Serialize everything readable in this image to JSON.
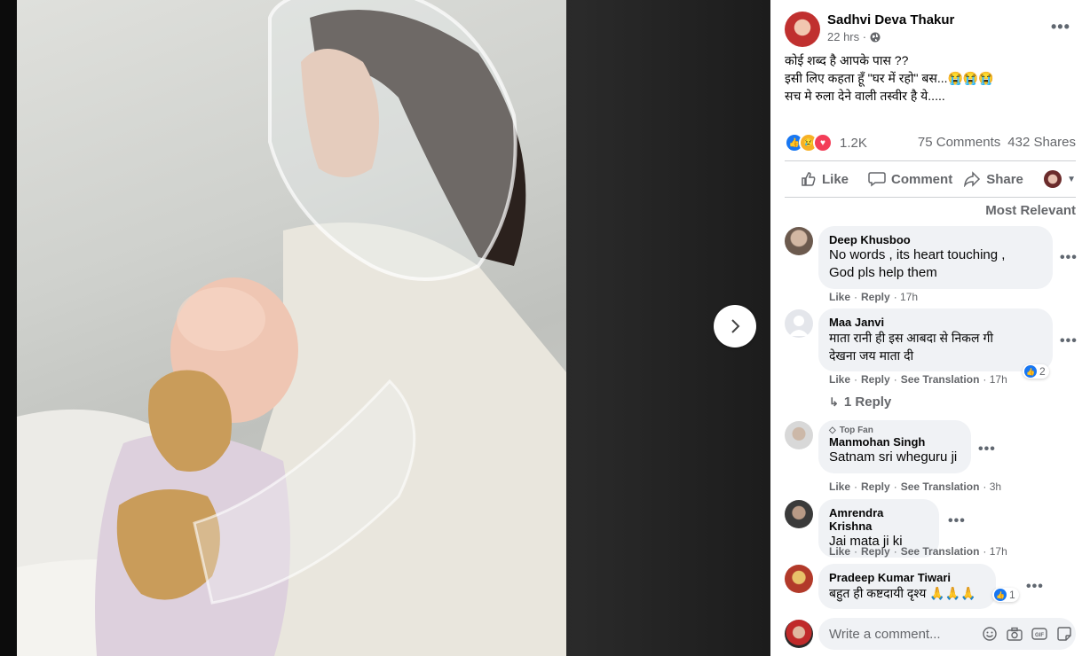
{
  "post": {
    "author": "Sadhvi Deva Thakur",
    "time": "22 hrs ·",
    "caption": [
      "कोई शब्द है आपके पास ??",
      "इसी लिए कहता हूँ \"घर में रहो\" बस...😭😭😭",
      "सच मे रुला देने वाली तस्वीर है ये....."
    ],
    "reaction_count": "1.2K",
    "comments_count": "75 Comments",
    "shares_count": "432 Shares"
  },
  "actions": {
    "like": "Like",
    "comment": "Comment",
    "share": "Share"
  },
  "sort_label": "Most Relevant",
  "comments": [
    {
      "name": "Deep Khusboo",
      "text1": "No words , its heart touching ,",
      "text2": "God pls help them",
      "like": "Like",
      "reply": "Reply",
      "time": "· 17h"
    },
    {
      "name": "Maa Janvi",
      "text1": "माता रानी ही इस आबदा से निकल गी",
      "text2": "देखना जय माता दी",
      "like": "Like",
      "reply": "Reply",
      "translate": "See Translation",
      "time": "· 17h",
      "reactions": "2",
      "replies": "1 Reply"
    },
    {
      "badge": "Top Fan",
      "name": "Manmohan Singh",
      "text1": "Satnam sri wheguru ji",
      "like": "Like",
      "reply": "Reply",
      "translate": "See Translation",
      "time": "· 3h"
    },
    {
      "name": "Amrendra Krishna",
      "text1": "Jai mata ji ki",
      "like": "Like",
      "reply": "Reply",
      "translate": "See Translation",
      "time": "· 17h"
    },
    {
      "name": "Pradeep Kumar Tiwari",
      "text1": "बहुत ही कष्टदायी दृश्य 🙏🙏🙏",
      "reactions": "1"
    }
  ],
  "write_comment": {
    "placeholder": "Write a comment..."
  },
  "colors": {
    "accent": "#1877f2",
    "love": "#f33e58",
    "haha": "#f7b125"
  }
}
